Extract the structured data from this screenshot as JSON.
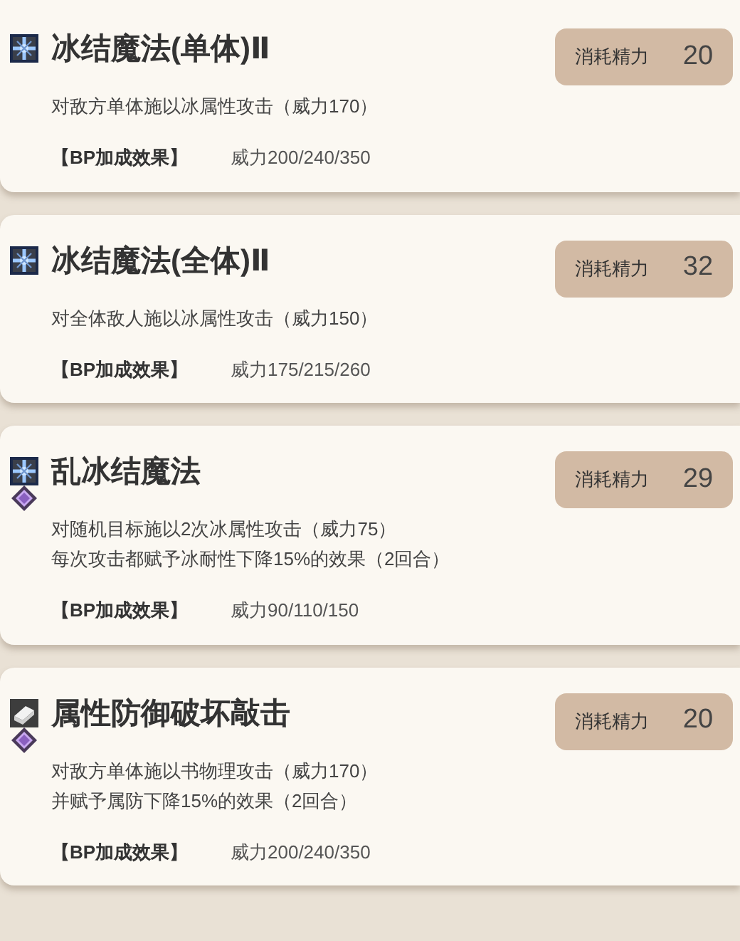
{
  "skills": [
    {
      "title": "冰结魔法(单体)Ⅱ",
      "icons": [
        {
          "kind": "ice"
        }
      ],
      "cost_label": "消耗精力",
      "cost": "20",
      "description": [
        "对敌方单体施以冰属性攻击（威力170）"
      ],
      "bp_label": "【BP加成效果】",
      "bp_value": "威力200/240/350"
    },
    {
      "title": "冰结魔法(全体)Ⅱ",
      "icons": [
        {
          "kind": "ice"
        }
      ],
      "cost_label": "消耗精力",
      "cost": "32",
      "description": [
        "对全体敌人施以冰属性攻击（威力150）"
      ],
      "bp_label": "【BP加成效果】",
      "bp_value": "威力175/215/260"
    },
    {
      "title": "乱冰结魔法",
      "icons": [
        {
          "kind": "ice"
        },
        {
          "kind": "diamond"
        }
      ],
      "cost_label": "消耗精力",
      "cost": "29",
      "description": [
        "对随机目标施以2次冰属性攻击（威力75）",
        "每次攻击都赋予冰耐性下降15%的效果（2回合）"
      ],
      "bp_label": "【BP加成效果】",
      "bp_value": "威力90/110/150"
    },
    {
      "title": "属性防御破坏敲击",
      "icons": [
        {
          "kind": "book"
        },
        {
          "kind": "diamond"
        }
      ],
      "cost_label": "消耗精力",
      "cost": "20",
      "description": [
        "对敌方单体施以书物理攻击（威力170）",
        "并赋予属防下降15%的效果（2回合）"
      ],
      "bp_label": "【BP加成效果】",
      "bp_value": "威力200/240/350"
    }
  ]
}
